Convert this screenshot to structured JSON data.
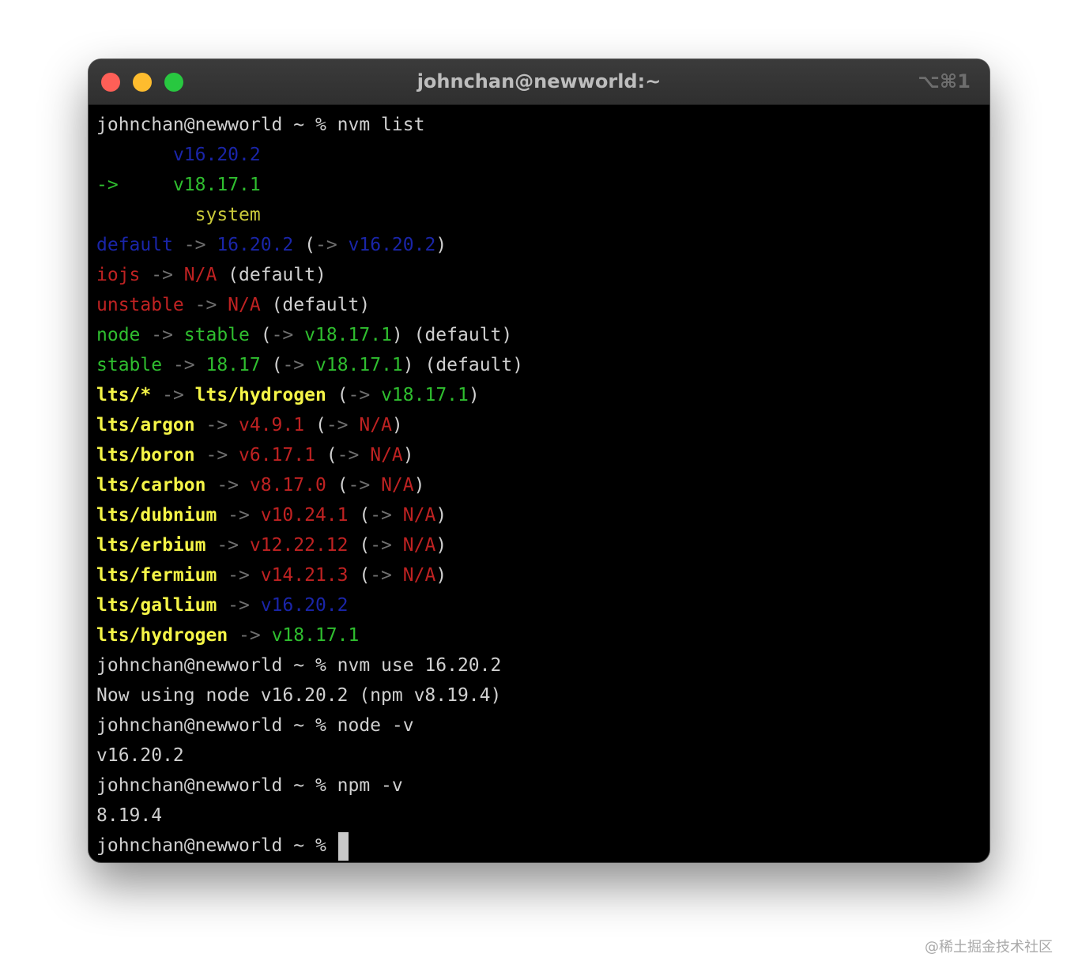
{
  "window": {
    "title": "johnchan@newworld:~",
    "shortcut": "⌥⌘1",
    "colors": {
      "close": "#fe5f57",
      "minimize": "#febc2e",
      "maximize": "#28c840",
      "background": "#000000"
    }
  },
  "terminal": {
    "prompt": "johnchan@newworld ~ % ",
    "lines": [
      [
        {
          "t": "johnchan@newworld ~ % nvm list",
          "c": ""
        }
      ],
      [
        {
          "t": "       ",
          "c": ""
        },
        {
          "t": "v16.20.2",
          "c": "b"
        }
      ],
      [
        {
          "t": "->",
          "c": "g"
        },
        {
          "t": "     ",
          "c": ""
        },
        {
          "t": "v18.17.1",
          "c": "g"
        }
      ],
      [
        {
          "t": "         ",
          "c": ""
        },
        {
          "t": "system",
          "c": "yd"
        }
      ],
      [
        {
          "t": "default",
          "c": "b"
        },
        {
          "t": " -> ",
          "c": "gr"
        },
        {
          "t": "16.20.2",
          "c": "b"
        },
        {
          "t": " (",
          "c": ""
        },
        {
          "t": "->",
          "c": "gr"
        },
        {
          "t": " ",
          "c": ""
        },
        {
          "t": "v16.20.2",
          "c": "b"
        },
        {
          "t": ")",
          "c": ""
        }
      ],
      [
        {
          "t": "iojs",
          "c": "r"
        },
        {
          "t": " -> ",
          "c": "gr"
        },
        {
          "t": "N/A",
          "c": "r"
        },
        {
          "t": " (default)",
          "c": ""
        }
      ],
      [
        {
          "t": "unstable",
          "c": "r"
        },
        {
          "t": " -> ",
          "c": "gr"
        },
        {
          "t": "N/A",
          "c": "r"
        },
        {
          "t": " (default)",
          "c": ""
        }
      ],
      [
        {
          "t": "node",
          "c": "g"
        },
        {
          "t": " -> ",
          "c": "gr"
        },
        {
          "t": "stable",
          "c": "g"
        },
        {
          "t": " (",
          "c": ""
        },
        {
          "t": "->",
          "c": "gr"
        },
        {
          "t": " ",
          "c": ""
        },
        {
          "t": "v18.17.1",
          "c": "g"
        },
        {
          "t": ") (default)",
          "c": ""
        }
      ],
      [
        {
          "t": "stable",
          "c": "g"
        },
        {
          "t": " -> ",
          "c": "gr"
        },
        {
          "t": "18.17",
          "c": "g"
        },
        {
          "t": " (",
          "c": ""
        },
        {
          "t": "->",
          "c": "gr"
        },
        {
          "t": " ",
          "c": ""
        },
        {
          "t": "v18.17.1",
          "c": "g"
        },
        {
          "t": ") (default)",
          "c": ""
        }
      ],
      [
        {
          "t": "lts/*",
          "c": "y"
        },
        {
          "t": " -> ",
          "c": "gr"
        },
        {
          "t": "lts/hydrogen",
          "c": "y"
        },
        {
          "t": " (",
          "c": ""
        },
        {
          "t": "->",
          "c": "gr"
        },
        {
          "t": " ",
          "c": ""
        },
        {
          "t": "v18.17.1",
          "c": "g"
        },
        {
          "t": ")",
          "c": ""
        }
      ],
      [
        {
          "t": "lts/argon",
          "c": "y"
        },
        {
          "t": " -> ",
          "c": "gr"
        },
        {
          "t": "v4.9.1",
          "c": "r"
        },
        {
          "t": " (",
          "c": ""
        },
        {
          "t": "->",
          "c": "gr"
        },
        {
          "t": " ",
          "c": ""
        },
        {
          "t": "N/A",
          "c": "r"
        },
        {
          "t": ")",
          "c": ""
        }
      ],
      [
        {
          "t": "lts/boron",
          "c": "y"
        },
        {
          "t": " -> ",
          "c": "gr"
        },
        {
          "t": "v6.17.1",
          "c": "r"
        },
        {
          "t": " (",
          "c": ""
        },
        {
          "t": "->",
          "c": "gr"
        },
        {
          "t": " ",
          "c": ""
        },
        {
          "t": "N/A",
          "c": "r"
        },
        {
          "t": ")",
          "c": ""
        }
      ],
      [
        {
          "t": "lts/carbon",
          "c": "y"
        },
        {
          "t": " -> ",
          "c": "gr"
        },
        {
          "t": "v8.17.0",
          "c": "r"
        },
        {
          "t": " (",
          "c": ""
        },
        {
          "t": "->",
          "c": "gr"
        },
        {
          "t": " ",
          "c": ""
        },
        {
          "t": "N/A",
          "c": "r"
        },
        {
          "t": ")",
          "c": ""
        }
      ],
      [
        {
          "t": "lts/dubnium",
          "c": "y"
        },
        {
          "t": " -> ",
          "c": "gr"
        },
        {
          "t": "v10.24.1",
          "c": "r"
        },
        {
          "t": " (",
          "c": ""
        },
        {
          "t": "->",
          "c": "gr"
        },
        {
          "t": " ",
          "c": ""
        },
        {
          "t": "N/A",
          "c": "r"
        },
        {
          "t": ")",
          "c": ""
        }
      ],
      [
        {
          "t": "lts/erbium",
          "c": "y"
        },
        {
          "t": " -> ",
          "c": "gr"
        },
        {
          "t": "v12.22.12",
          "c": "r"
        },
        {
          "t": " (",
          "c": ""
        },
        {
          "t": "->",
          "c": "gr"
        },
        {
          "t": " ",
          "c": ""
        },
        {
          "t": "N/A",
          "c": "r"
        },
        {
          "t": ")",
          "c": ""
        }
      ],
      [
        {
          "t": "lts/fermium",
          "c": "y"
        },
        {
          "t": " -> ",
          "c": "gr"
        },
        {
          "t": "v14.21.3",
          "c": "r"
        },
        {
          "t": " (",
          "c": ""
        },
        {
          "t": "->",
          "c": "gr"
        },
        {
          "t": " ",
          "c": ""
        },
        {
          "t": "N/A",
          "c": "r"
        },
        {
          "t": ")",
          "c": ""
        }
      ],
      [
        {
          "t": "lts/gallium",
          "c": "y"
        },
        {
          "t": " -> ",
          "c": "gr"
        },
        {
          "t": "v16.20.2",
          "c": "b"
        }
      ],
      [
        {
          "t": "lts/hydrogen",
          "c": "y"
        },
        {
          "t": " -> ",
          "c": "gr"
        },
        {
          "t": "v18.17.1",
          "c": "g"
        }
      ],
      [
        {
          "t": "johnchan@newworld ~ % nvm use 16.20.2",
          "c": ""
        }
      ],
      [
        {
          "t": "Now using node v16.20.2 (npm v8.19.4)",
          "c": ""
        }
      ],
      [
        {
          "t": "johnchan@newworld ~ % node -v",
          "c": ""
        }
      ],
      [
        {
          "t": "v16.20.2",
          "c": ""
        }
      ],
      [
        {
          "t": "johnchan@newworld ~ % npm -v",
          "c": ""
        }
      ],
      [
        {
          "t": "8.19.4",
          "c": ""
        }
      ]
    ]
  },
  "watermark": "@稀土掘金技术社区"
}
